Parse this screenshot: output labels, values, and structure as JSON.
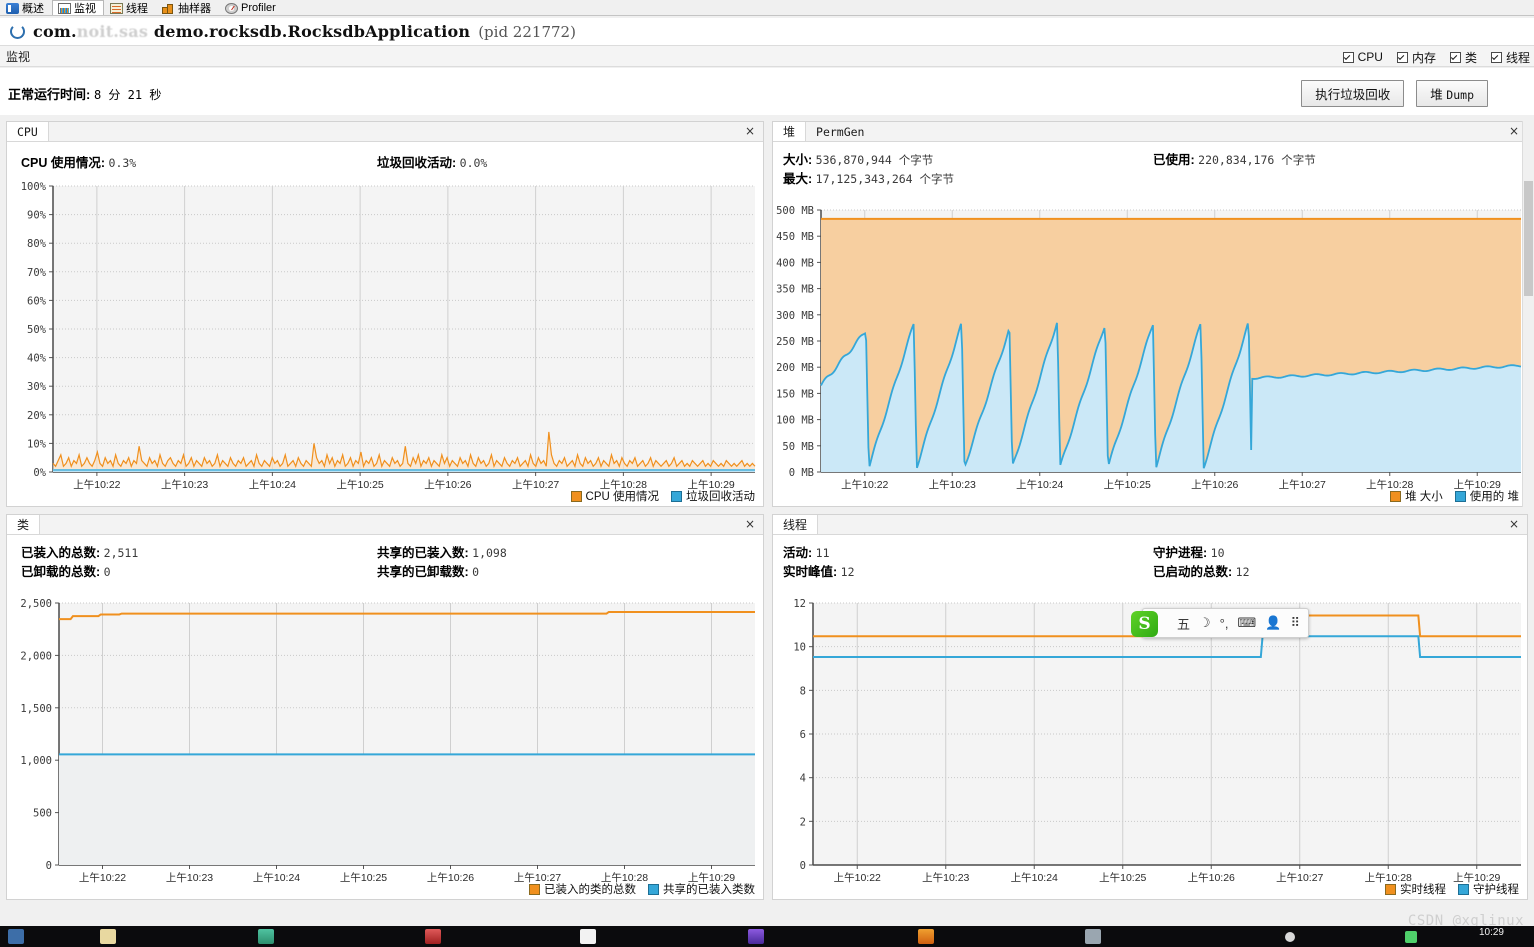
{
  "tabs": [
    {
      "label": "概述",
      "icon": "overview-icon",
      "active": false
    },
    {
      "label": "监视",
      "icon": "monitor-icon",
      "active": true
    },
    {
      "label": "线程",
      "icon": "threads-icon",
      "active": false
    },
    {
      "label": "抽样器",
      "icon": "sampler-icon",
      "active": false
    },
    {
      "label": "Profiler",
      "icon": "profiler-icon",
      "active": false
    }
  ],
  "app": {
    "name_visible_prefix": "com.",
    "name_blurred": "noit.sas",
    "name_visible_suffix": "demo.rocksdb.RocksdbApplication",
    "full_title": "com. noit.sas  demo.rocksdb.RocksdbApplication",
    "pid_text": "(pid 221772)"
  },
  "monitor_header": {
    "label": "监视",
    "checkboxes": [
      {
        "label": "CPU",
        "checked": true
      },
      {
        "label": "内存",
        "checked": true
      },
      {
        "label": "类",
        "checked": true
      },
      {
        "label": "线程",
        "checked": true
      }
    ]
  },
  "uptime": {
    "label": "正常运行时间:",
    "value": "8 分 21 秒"
  },
  "buttons": {
    "gc": "执行垃圾回收",
    "heap_dump_cn": "堆",
    "heap_dump_en": "Dump"
  },
  "cpu_panel": {
    "tab": "CPU",
    "close": "×",
    "stats": [
      {
        "label": "CPU 使用情况:",
        "value": "0.3%"
      },
      {
        "label": "垃圾回收活动:",
        "value": "0.0%"
      }
    ]
  },
  "heap_panel": {
    "tabs": [
      "堆",
      "PermGen"
    ],
    "selected_tab": "堆",
    "close": "×",
    "stats": [
      {
        "label": "大小:",
        "value": "536,870,944 个字节"
      },
      {
        "label": "最大:",
        "value": "17,125,343,264 个字节"
      },
      {
        "label": "已使用:",
        "value": "220,834,176 个字节"
      }
    ]
  },
  "classes_panel": {
    "tab": "类",
    "close": "×",
    "stats": [
      {
        "label": "已装入的总数:",
        "value": "2,511"
      },
      {
        "label": "已卸载的总数:",
        "value": "0"
      },
      {
        "label": "共享的已装入数:",
        "value": "1,098"
      },
      {
        "label": "共享的已卸载数:",
        "value": "0"
      }
    ]
  },
  "threads_panel": {
    "tab": "线程",
    "close": "×",
    "stats": [
      {
        "label": "活动:",
        "value": "11"
      },
      {
        "label": "实时峰值:",
        "value": "12"
      },
      {
        "label": "守护进程:",
        "value": "10"
      },
      {
        "label": "已启动的总数:",
        "value": "12"
      }
    ]
  },
  "colors": {
    "orange": "#f0901e",
    "orange_fill": "#f7cfa0",
    "blue": "#35a7d8",
    "blue_fill": "#bfe4f5",
    "plot_bg": "#f4f4f4",
    "grid": "#c9c9c9",
    "axis": "#555555"
  },
  "chart_data": [
    {
      "id": "cpu-chart",
      "type": "area",
      "title": "CPU",
      "xlabel": "",
      "ylabel": "",
      "ylim": [
        0,
        100
      ],
      "yticks": [
        "0%",
        "10%",
        "20%",
        "30%",
        "40%",
        "50%",
        "60%",
        "70%",
        "80%",
        "90%",
        "100%"
      ],
      "xticks": [
        "上午10:22",
        "上午10:23",
        "上午10:24",
        "上午10:25",
        "上午10:26",
        "上午10:27",
        "上午10:28",
        "上午10:29"
      ],
      "grid": true,
      "legend_position": "bottom-right",
      "series": [
        {
          "name": "CPU 使用情况",
          "color": "#f0901e",
          "values": [
            3,
            2,
            4,
            6,
            2,
            3,
            5,
            2,
            4,
            3,
            6,
            2,
            3,
            5,
            3,
            2,
            4,
            7,
            3,
            2,
            5,
            3,
            4,
            2,
            6,
            3,
            2,
            4,
            3,
            5,
            2,
            4,
            3,
            9,
            4,
            3,
            2,
            5,
            3,
            4,
            2,
            6,
            3,
            2,
            4,
            5,
            3,
            2,
            4,
            3,
            6,
            2,
            3,
            5,
            2,
            4,
            3,
            2,
            5,
            3,
            4,
            2,
            3,
            6,
            2,
            4,
            3,
            2,
            5,
            3,
            2,
            4,
            3,
            5,
            2,
            3,
            4,
            2,
            6,
            3,
            2,
            4,
            3,
            2,
            5,
            3,
            4,
            2,
            3,
            6,
            2,
            3,
            4,
            2,
            5,
            3,
            2,
            4,
            3,
            2,
            10,
            5,
            3,
            4,
            2,
            6,
            3,
            5,
            2,
            4,
            3,
            6,
            2,
            3,
            5,
            2,
            4,
            3,
            7,
            2,
            4,
            3,
            5,
            2,
            3,
            6,
            2,
            4,
            3,
            2,
            5,
            3,
            4,
            2,
            3,
            9,
            3,
            2,
            5,
            3,
            6,
            2,
            4,
            3,
            5,
            2,
            4,
            3,
            2,
            6,
            3,
            5,
            2,
            4,
            3,
            2,
            5,
            3,
            4,
            2,
            6,
            3,
            2,
            5,
            3,
            4,
            2,
            3,
            6,
            2,
            4,
            3,
            2,
            5,
            3,
            2,
            4,
            3,
            5,
            2,
            3,
            4,
            2,
            6,
            3,
            2,
            5,
            3,
            4,
            2,
            14,
            6,
            3,
            2,
            4,
            3,
            5,
            2,
            3,
            4,
            2,
            6,
            3,
            2,
            5,
            3,
            4,
            2,
            3,
            5,
            2,
            4,
            3,
            2,
            6,
            3,
            4,
            2,
            5,
            3,
            2,
            4,
            3,
            5,
            2,
            3,
            4,
            2,
            3,
            5,
            2,
            4,
            3,
            2,
            3,
            4,
            2,
            3,
            5,
            2,
            3,
            4,
            2,
            3,
            2,
            4,
            3,
            2,
            3,
            4,
            2,
            3,
            2,
            4,
            3,
            2,
            3,
            2,
            4,
            3,
            2,
            3,
            2,
            3,
            4,
            2,
            3,
            2,
            3,
            2
          ]
        },
        {
          "name": "垃圾回收活动",
          "color": "#35a7d8",
          "values": [
            0,
            0,
            0,
            0,
            0,
            0,
            0,
            0,
            0,
            0,
            0,
            0,
            0,
            0,
            0,
            0,
            0,
            0,
            0,
            0,
            0,
            0,
            0,
            0,
            0,
            0,
            0,
            0,
            0,
            0
          ]
        }
      ]
    },
    {
      "id": "heap-chart",
      "type": "area",
      "title": "堆",
      "xlabel": "",
      "ylabel": "",
      "ylim": [
        0,
        512
      ],
      "yticks": [
        "0 MB",
        "50 MB",
        "100 MB",
        "150 MB",
        "200 MB",
        "250 MB",
        "300 MB",
        "350 MB",
        "400 MB",
        "450 MB",
        "500 MB"
      ],
      "xticks": [
        "上午10:22",
        "上午10:23",
        "上午10:24",
        "上午10:25",
        "上午10:26",
        "上午10:27",
        "上午10:28",
        "上午10:29"
      ],
      "grid": true,
      "legend_position": "bottom-right",
      "series": [
        {
          "name": "堆 大小",
          "color": "#f0901e",
          "constant_mb": 512
        },
        {
          "name": "使用的 堆",
          "color": "#35a7d8",
          "sawtooth": {
            "peaks_mb": [
              285,
              300,
              300,
              290,
              305,
              300,
              300,
              300,
              302
            ],
            "trough_mb": 10,
            "start_mb": 175,
            "flat_after_x": 0.615,
            "flat_from_mb": 190,
            "flat_to_mb": 215
          }
        }
      ]
    },
    {
      "id": "classes-chart",
      "type": "line",
      "title": "类",
      "xlabel": "",
      "ylabel": "",
      "ylim": [
        0,
        2600
      ],
      "yticks": [
        "0",
        "500",
        "1,000",
        "1,500",
        "2,000",
        "2,500"
      ],
      "xticks": [
        "上午10:22",
        "上午10:23",
        "上午10:24",
        "上午10:25",
        "上午10:26",
        "上午10:27",
        "上午10:28",
        "上午10:29"
      ],
      "grid": true,
      "legend_position": "bottom-right",
      "series": [
        {
          "name": "已装入的类的总数",
          "color": "#f0901e",
          "start_value": 2440,
          "end_value": 2511
        },
        {
          "name": "共享的已装入类数",
          "color": "#35a7d8",
          "start_value": 1098,
          "end_value": 1098
        }
      ]
    },
    {
      "id": "threads-chart",
      "type": "line",
      "title": "线程",
      "xlabel": "",
      "ylabel": "",
      "ylim": [
        0,
        12.6
      ],
      "yticks": [
        "0",
        "2",
        "4",
        "6",
        "8",
        "10",
        "12"
      ],
      "xticks": [
        "上午10:22",
        "上午10:23",
        "上午10:24",
        "上午10:25",
        "上午10:26",
        "上午10:27",
        "上午10:28",
        "上午10:29"
      ],
      "grid": true,
      "legend_position": "bottom-right",
      "series": [
        {
          "name": "实时线程",
          "color": "#f0901e",
          "base_value": 11,
          "bump_value": 12,
          "bump_from_x": 0.635,
          "bump_to_x": 0.855
        },
        {
          "name": "守护线程",
          "color": "#35a7d8",
          "base_value": 10,
          "bump_value": 11,
          "bump_from_x": 0.635,
          "bump_to_x": 0.855
        }
      ]
    }
  ],
  "ime": {
    "logo": "S",
    "items": [
      "五",
      "☽",
      "°,",
      "⌨",
      "👤",
      "⠿"
    ]
  },
  "watermark": "CSDN @xglinux",
  "taskbar": {
    "clock_time": "10:29",
    "items": [
      "",
      "",
      "",
      "",
      "",
      "",
      "",
      "",
      "",
      "",
      ""
    ]
  }
}
